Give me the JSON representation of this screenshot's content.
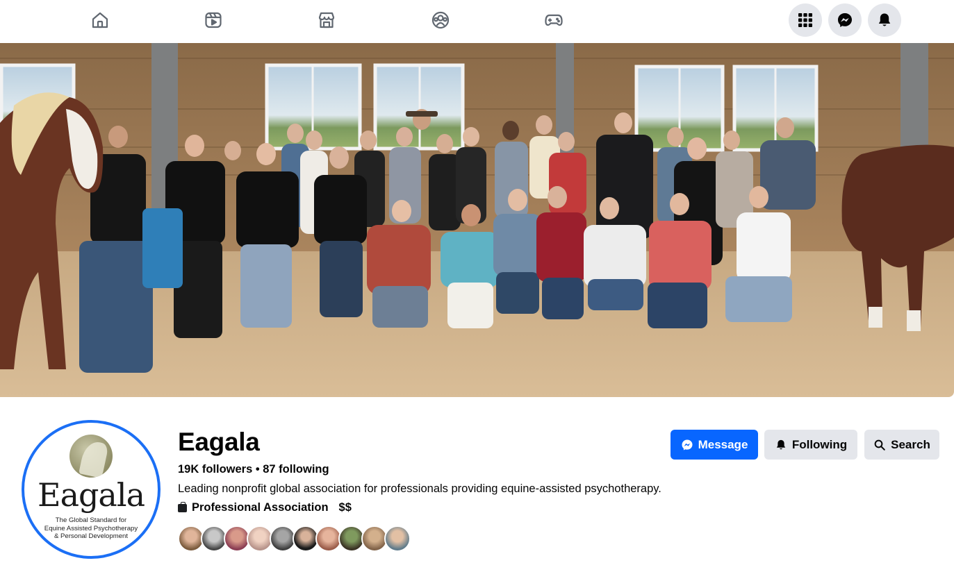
{
  "nav": {
    "tabs": [
      {
        "name": "home",
        "icon": "home-icon"
      },
      {
        "name": "video",
        "icon": "video-icon"
      },
      {
        "name": "marketplace",
        "icon": "marketplace-icon"
      },
      {
        "name": "groups",
        "icon": "groups-icon"
      },
      {
        "name": "gaming",
        "icon": "gaming-icon"
      }
    ],
    "right_buttons": [
      {
        "name": "menu",
        "icon": "grid-menu-icon"
      },
      {
        "name": "messenger",
        "icon": "messenger-icon"
      },
      {
        "name": "notifications",
        "icon": "bell-icon"
      }
    ]
  },
  "profile": {
    "name": "Eagala",
    "stats": "19K followers • 87 following",
    "bio": "Leading nonprofit global association for professionals providing equine-assisted psychotherapy.",
    "category": "Professional Association",
    "price": "$$"
  },
  "logo": {
    "word": "Eagala",
    "tagline_1": "The Global Standard for",
    "tagline_2": "Equine Assisted Psychotherapy",
    "tagline_3": "& Personal Development"
  },
  "actions": {
    "message_label": "Message",
    "following_label": "Following",
    "search_label": "Search"
  },
  "colors": {
    "accent": "#0866ff",
    "secondary_button": "#e4e6eb",
    "avatar_ring": "#1b6ff5"
  },
  "friend_avatars": 10
}
